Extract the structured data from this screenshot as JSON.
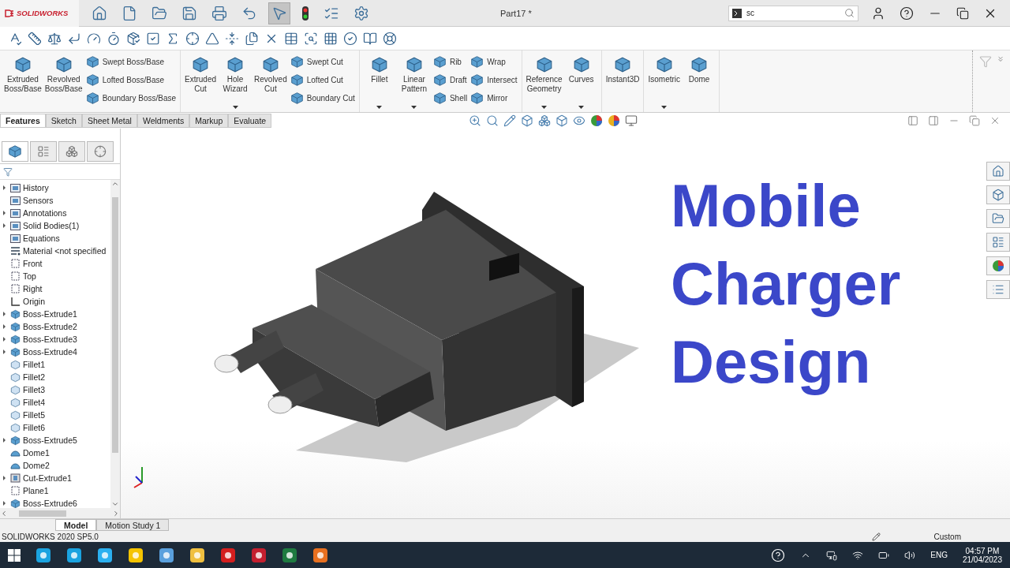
{
  "window": {
    "logo_text": "SOLIDWORKS",
    "title": "Part17 *",
    "search": {
      "value": "sc"
    },
    "select_active": true
  },
  "ribbon": [
    {
      "items": [
        {
          "kind": "large",
          "label": "Extruded\nBoss/Base",
          "dropdown": false
        },
        {
          "kind": "large",
          "label": "Revolved\nBoss/Base",
          "dropdown": false
        },
        {
          "kind": "stack",
          "items": [
            "Swept Boss/Base",
            "Lofted Boss/Base",
            "Boundary Boss/Base"
          ]
        }
      ]
    },
    {
      "items": [
        {
          "kind": "large",
          "label": "Extruded\nCut",
          "dropdown": false
        },
        {
          "kind": "large",
          "label": "Hole\nWizard",
          "dropdown": true
        },
        {
          "kind": "large",
          "label": "Revolved\nCut",
          "dropdown": false
        },
        {
          "kind": "stack",
          "items": [
            "Swept Cut",
            "Lofted Cut",
            "Boundary Cut"
          ]
        }
      ]
    },
    {
      "items": [
        {
          "kind": "large",
          "label": "Fillet",
          "dropdown": true
        },
        {
          "kind": "large",
          "label": "Linear\nPattern",
          "dropdown": true
        },
        {
          "kind": "stack",
          "items": [
            "Rib",
            "Draft",
            "Shell"
          ]
        },
        {
          "kind": "stack",
          "items": [
            "Wrap",
            "Intersect",
            "Mirror"
          ]
        }
      ]
    },
    {
      "items": [
        {
          "kind": "large",
          "label": "Reference\nGeometry",
          "dropdown": true
        },
        {
          "kind": "large",
          "label": "Curves",
          "dropdown": true
        }
      ]
    },
    {
      "items": [
        {
          "kind": "large",
          "label": "Instant3D",
          "dropdown": false
        }
      ]
    },
    {
      "items": [
        {
          "kind": "large",
          "label": "Isometric",
          "dropdown": true
        },
        {
          "kind": "large",
          "label": "Dome",
          "dropdown": false
        }
      ]
    }
  ],
  "tabs": [
    {
      "label": "Features",
      "selected": true
    },
    {
      "label": "Sketch",
      "selected": false
    },
    {
      "label": "Sheet Metal",
      "selected": false
    },
    {
      "label": "Weldments",
      "selected": false
    },
    {
      "label": "Markup",
      "selected": false
    },
    {
      "label": "Evaluate",
      "selected": false
    }
  ],
  "panel_tabs": [
    {
      "selected": true
    },
    {
      "selected": false
    },
    {
      "selected": false
    },
    {
      "selected": false
    }
  ],
  "tree": [
    {
      "label": "History",
      "kind": "folder",
      "expandable": true
    },
    {
      "label": "Sensors",
      "kind": "folder",
      "expandable": false
    },
    {
      "label": "Annotations",
      "kind": "folder",
      "expandable": true
    },
    {
      "label": "Solid Bodies(1)",
      "kind": "folder",
      "expandable": true
    },
    {
      "label": "Equations",
      "kind": "folder",
      "expandable": false
    },
    {
      "label": "Material <not specified",
      "kind": "material",
      "expandable": false
    },
    {
      "label": "Front",
      "kind": "plane",
      "expandable": false
    },
    {
      "label": "Top",
      "kind": "plane",
      "expandable": false
    },
    {
      "label": "Right",
      "kind": "plane",
      "expandable": false
    },
    {
      "label": "Origin",
      "kind": "origin",
      "expandable": false
    },
    {
      "label": "Boss-Extrude1",
      "kind": "extrude",
      "expandable": true
    },
    {
      "label": "Boss-Extrude2",
      "kind": "extrude",
      "expandable": true
    },
    {
      "label": "Boss-Extrude3",
      "kind": "extrude",
      "expandable": true
    },
    {
      "label": "Boss-Extrude4",
      "kind": "extrude",
      "expandable": true
    },
    {
      "label": "Fillet1",
      "kind": "fillet",
      "expandable": false
    },
    {
      "label": "Fillet2",
      "kind": "fillet",
      "expandable": false
    },
    {
      "label": "Fillet3",
      "kind": "fillet",
      "expandable": false
    },
    {
      "label": "Fillet4",
      "kind": "fillet",
      "expandable": false
    },
    {
      "label": "Fillet5",
      "kind": "fillet",
      "expandable": false
    },
    {
      "label": "Fillet6",
      "kind": "fillet",
      "expandable": false
    },
    {
      "label": "Boss-Extrude5",
      "kind": "extrude",
      "expandable": true
    },
    {
      "label": "Dome1",
      "kind": "dome",
      "expandable": false
    },
    {
      "label": "Dome2",
      "kind": "dome",
      "expandable": false
    },
    {
      "label": "Cut-Extrude1",
      "kind": "cut",
      "expandable": true
    },
    {
      "label": "Plane1",
      "kind": "plane",
      "expandable": false
    },
    {
      "label": "Boss-Extrude6",
      "kind": "extrude",
      "expandable": true
    }
  ],
  "viewport": {
    "title_lines": [
      "Mobile",
      "Charger",
      "Design"
    ]
  },
  "bottom_tabs": [
    {
      "label": "Model",
      "selected": true
    },
    {
      "label": "Motion Study 1",
      "selected": false
    }
  ],
  "status_bar": {
    "version": "SOLIDWORKS 2020 SP5.0",
    "units": "Custom"
  },
  "taskbar": {
    "language": "ENG",
    "time": "04:57 PM",
    "date": "21/04/2023"
  }
}
